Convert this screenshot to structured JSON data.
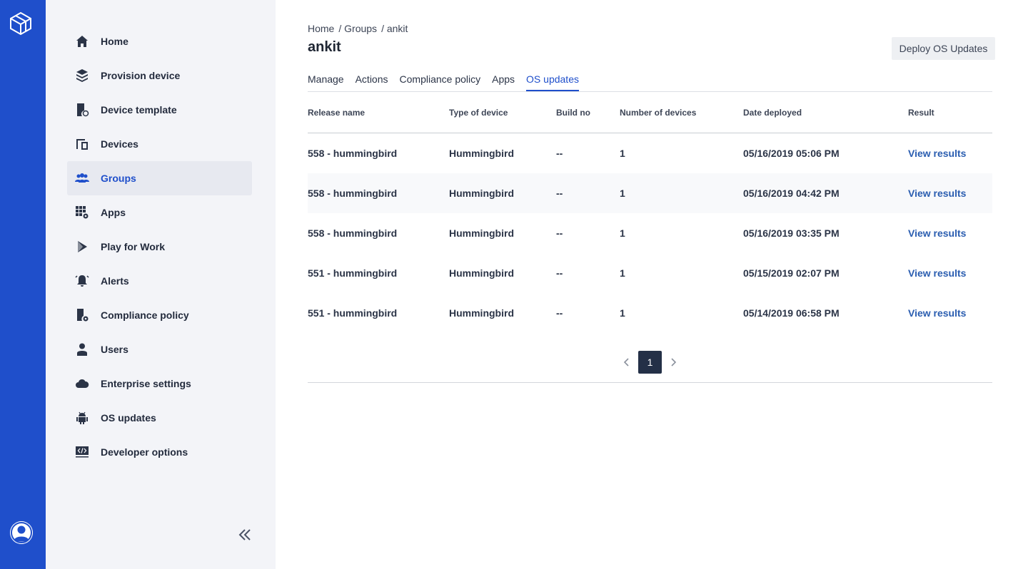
{
  "sidebar": {
    "items": [
      {
        "label": "Home",
        "icon": "home-icon"
      },
      {
        "label": "Provision device",
        "icon": "provision-icon"
      },
      {
        "label": "Device template",
        "icon": "template-icon"
      },
      {
        "label": "Devices",
        "icon": "devices-icon"
      },
      {
        "label": "Groups",
        "icon": "groups-icon",
        "active": true
      },
      {
        "label": "Apps",
        "icon": "apps-icon"
      },
      {
        "label": "Play for Work",
        "icon": "play-icon"
      },
      {
        "label": "Alerts",
        "icon": "bell-icon"
      },
      {
        "label": "Compliance policy",
        "icon": "compliance-icon"
      },
      {
        "label": "Users",
        "icon": "user-icon"
      },
      {
        "label": "Enterprise settings",
        "icon": "cloud-icon"
      },
      {
        "label": "OS updates",
        "icon": "android-icon"
      },
      {
        "label": "Developer options",
        "icon": "code-icon"
      }
    ]
  },
  "breadcrumb": {
    "home": "Home",
    "groups": "/ Groups",
    "current": "/ ankit"
  },
  "page": {
    "title": "ankit",
    "deploy_label": "Deploy OS Updates"
  },
  "tabs": [
    {
      "label": "Manage"
    },
    {
      "label": "Actions"
    },
    {
      "label": "Compliance policy"
    },
    {
      "label": "Apps"
    },
    {
      "label": "OS updates",
      "active": true
    }
  ],
  "table": {
    "headers": [
      "Release name",
      "Type of device",
      "Build no",
      "Number of devices",
      "Date deployed",
      "Result"
    ],
    "rows": [
      [
        "558 - hummingbird",
        "Hummingbird",
        "--",
        "1",
        "05/16/2019 05:06 PM",
        "View results"
      ],
      [
        "558 - hummingbird",
        "Hummingbird",
        "--",
        "1",
        "05/16/2019 04:42 PM",
        "View results"
      ],
      [
        "558 - hummingbird",
        "Hummingbird",
        "--",
        "1",
        "05/16/2019 03:35 PM",
        "View results"
      ],
      [
        "551 - hummingbird",
        "Hummingbird",
        "--",
        "1",
        "05/15/2019 02:07 PM",
        "View results"
      ],
      [
        "551 - hummingbird",
        "Hummingbird",
        "--",
        "1",
        "05/14/2019 06:58 PM",
        "View results"
      ]
    ]
  },
  "pagination": {
    "current": "1"
  },
  "colors": {
    "rail": "#1f4fcb",
    "accent": "#1f4fcb",
    "link": "#2a5db0",
    "page_active": "#243047"
  }
}
